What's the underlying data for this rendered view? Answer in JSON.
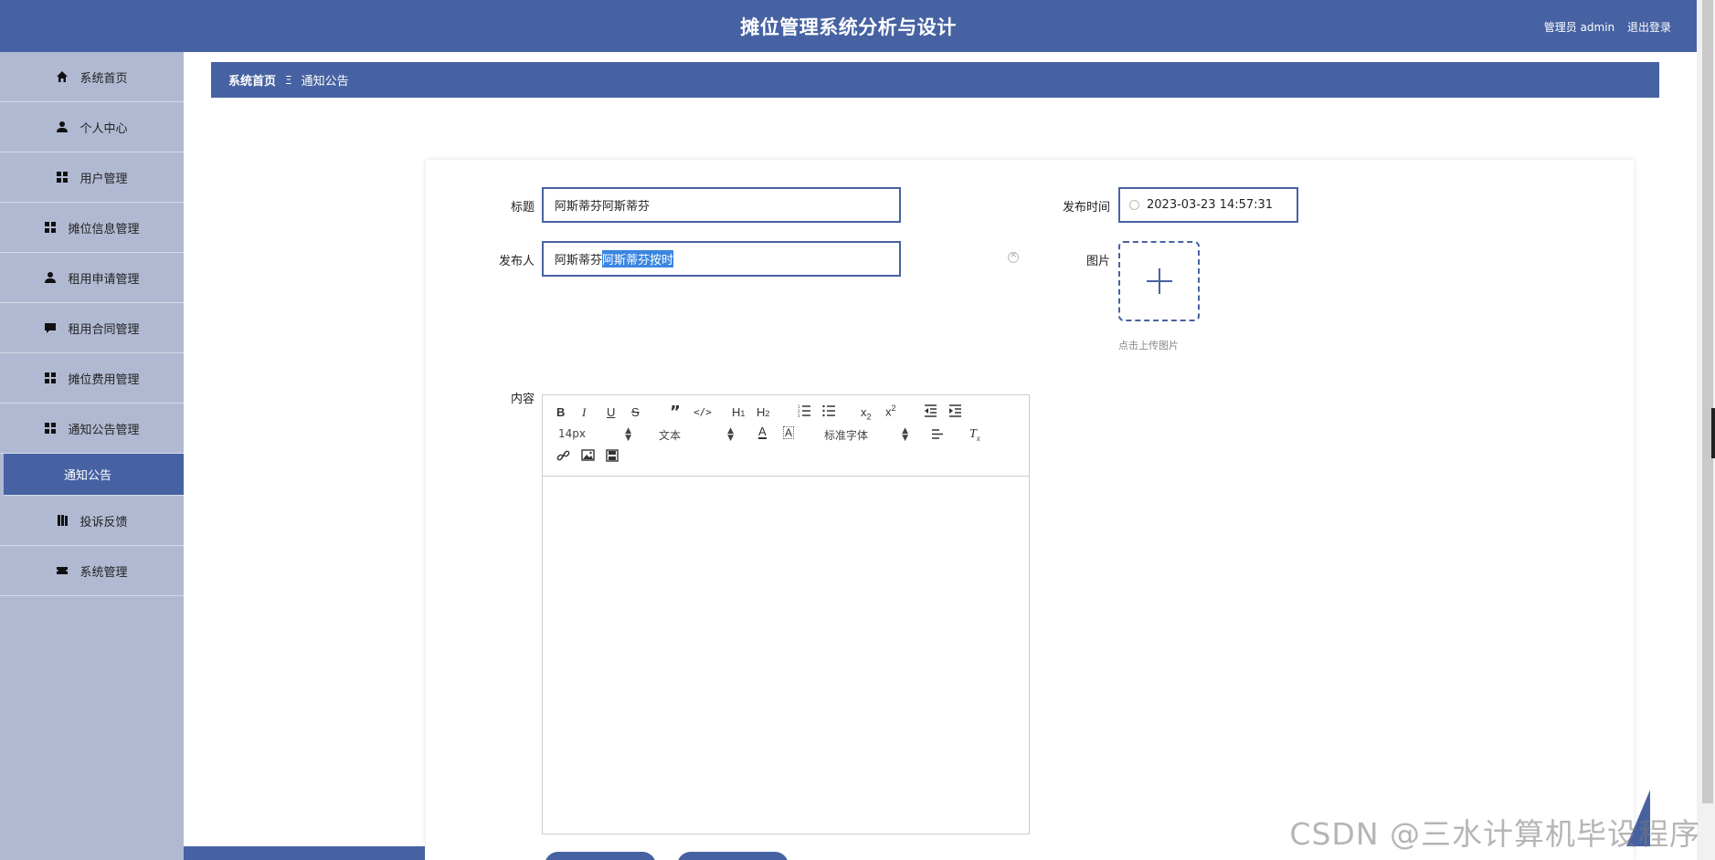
{
  "header": {
    "title": "摊位管理系统分析与设计",
    "role_user": "管理员 admin",
    "logout": "退出登录"
  },
  "sidebar": {
    "items": [
      {
        "label": "系统首页",
        "icon": "home-icon"
      },
      {
        "label": "个人中心",
        "icon": "user-icon"
      },
      {
        "label": "用户管理",
        "icon": "grid-icon"
      },
      {
        "label": "摊位信息管理",
        "icon": "grid-icon"
      },
      {
        "label": "租用申请管理",
        "icon": "user-icon"
      },
      {
        "label": "租用合同管理",
        "icon": "chat-icon"
      },
      {
        "label": "摊位费用管理",
        "icon": "grid-icon"
      },
      {
        "label": "通知公告管理",
        "icon": "grid-icon"
      },
      {
        "label": "投诉反馈",
        "icon": "book-icon"
      },
      {
        "label": "系统管理",
        "icon": "ticket-icon"
      }
    ],
    "active_sub": "通知公告"
  },
  "breadcrumb": {
    "home": "系统首页",
    "separator": "Ξ",
    "current": "通知公告"
  },
  "form": {
    "title_label": "标题",
    "title_value": "阿斯蒂芬阿斯蒂芬",
    "publisher_label": "发布人",
    "publisher_value_plain": "阿斯蒂芬",
    "publisher_value_selected": "阿斯蒂芬按时",
    "time_label": "发布时间",
    "time_value": "2023-03-23 14:57:31",
    "image_label": "图片",
    "upload_hint": "点击上传图片",
    "content_label": "内容"
  },
  "editor": {
    "bold": "B",
    "italic": "I",
    "underline": "U",
    "strike": "S",
    "quote": "”",
    "code": "</>",
    "h1": "H",
    "h1_sub": "1",
    "h2": "H",
    "h2_sub": "2",
    "sub": "x",
    "sub_sub": "2",
    "sup": "x",
    "sup_sup": "2",
    "size_value": "14px",
    "header_value": "文本",
    "font_value": "标准字体",
    "clean": "T",
    "clean_sub": "x",
    "color_letter": "A",
    "bg_letter": "A"
  },
  "watermark": "CSDN @三水计算机毕设程序",
  "colors": {
    "primary": "#4662a2",
    "sidebar_bg": "#b1b9d2",
    "selection": "#3a86e0"
  }
}
